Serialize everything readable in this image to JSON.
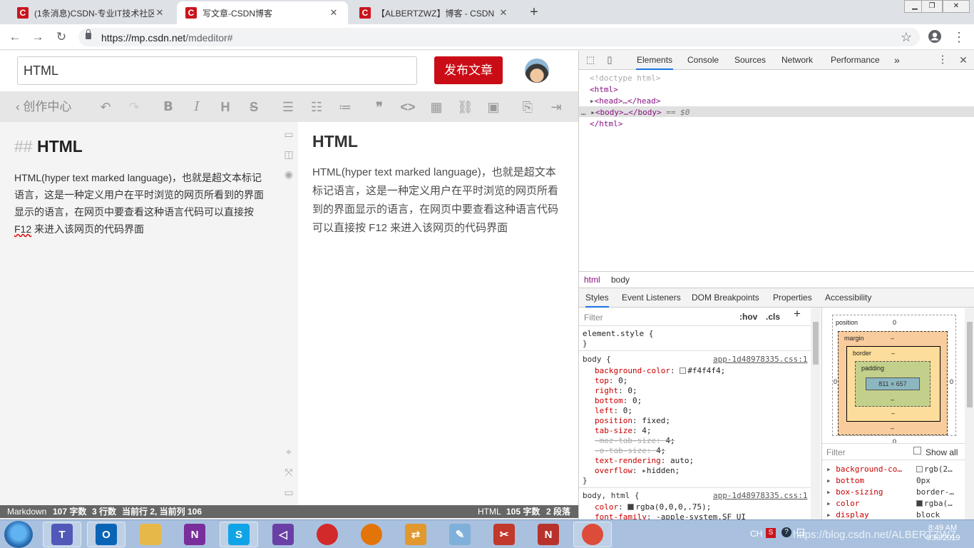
{
  "browser": {
    "tabs": [
      {
        "favicon": "C",
        "title": "(1条消息)CSDN-专业IT技术社区",
        "active": false
      },
      {
        "favicon": "C",
        "title": "写文章-CSDN博客",
        "active": true
      },
      {
        "favicon": "C",
        "title": "【ALBERTZWZ】博客 - CSDN",
        "active": false
      }
    ],
    "new_tab": "+",
    "close": "✕",
    "url_host": "https://mp.csdn.net",
    "url_path": "/mdeditor#",
    "window_buttons": [
      "▁",
      "❐",
      "✕"
    ]
  },
  "editor": {
    "title_value": "HTML",
    "publish_label": "发布文章",
    "back_label": "创作中心",
    "toolbar_icons": [
      "undo-icon",
      "redo-icon",
      "bold-icon",
      "italic-icon",
      "heading-icon",
      "strikethrough-icon",
      "unordered-list-icon",
      "ordered-list-icon",
      "task-list-icon",
      "quote-icon",
      "code-icon",
      "table-icon",
      "link-icon",
      "image-icon",
      "import-icon",
      "export-icon"
    ],
    "source": {
      "heading_marker": "##",
      "heading_text": "HTML",
      "para_before": "HTML(hyper text marked language)，也就是超文本标记语言，这是一种定义用户在平时浏览的网页所看到的界面显示的语言，在网页中要查看这种语言代码可以直接按 ",
      "para_key": "F12",
      "para_after": " 来进入该网页的代码界面"
    },
    "preview": {
      "heading": "HTML",
      "paragraph": "HTML(hyper text marked language)，也就是超文本标记语言，这是一种定义用户在平时浏览的网页所看到的界面显示的语言，在网页中要查看这种语言代码可以直接按 F12 来进入该网页的代码界面"
    },
    "status_left": {
      "mode": "Markdown",
      "words": "107 字数",
      "lines": "3 行数",
      "cursor": "当前行 2, 当前列 106"
    },
    "status_right": {
      "mode": "HTML",
      "words": "105 字数",
      "paras": "2 段落"
    }
  },
  "devtools": {
    "tabs": [
      "Elements",
      "Console",
      "Sources",
      "Network",
      "Performance"
    ],
    "more": "»",
    "dom": {
      "doctype": "<!doctype html>",
      "html_open": "<html>",
      "head": "<head>…</head>",
      "body": "<body>…</body>",
      "body_eq": "== $0",
      "html_close": "</html>",
      "ellipsis": "…"
    },
    "breadcrumbs": [
      "html",
      "body"
    ],
    "style_tabs": [
      "Styles",
      "Event Listeners",
      "DOM Breakpoints",
      "Properties",
      "Accessibility"
    ],
    "filter_placeholder": "Filter",
    "hov": ":hov",
    "cls": ".cls",
    "add": "+",
    "element_style": "element.style {",
    "close_brace": "}",
    "body_rule": {
      "selector": "body {",
      "source": "app-1d48978335.css:1",
      "decls": [
        {
          "prop": "background-color",
          "val": "#f4f4f4;",
          "swatch": "#f4f4f4",
          "struck": false
        },
        {
          "prop": "top",
          "val": "0;",
          "struck": false
        },
        {
          "prop": "right",
          "val": "0;",
          "struck": false
        },
        {
          "prop": "bottom",
          "val": "0;",
          "struck": false
        },
        {
          "prop": "left",
          "val": "0;",
          "struck": false
        },
        {
          "prop": "position",
          "val": "fixed;",
          "struck": false
        },
        {
          "prop": "tab-size",
          "val": "4;",
          "struck": false
        },
        {
          "prop": "-moz-tab-size",
          "val": "4;",
          "struck": true
        },
        {
          "prop": "-o-tab-size",
          "val": "4;",
          "struck": true
        },
        {
          "prop": "text-rendering",
          "val": "auto;",
          "struck": false
        },
        {
          "prop": "overflow",
          "val": "hidden;",
          "struck": false,
          "expand": true
        }
      ]
    },
    "body_html_rule": {
      "selector": "body, html {",
      "source": "app-1d48978335.css:1",
      "decls": [
        {
          "prop": "color",
          "val": "rgba(0,0,0,.75);",
          "swatch": "#404040"
        },
        {
          "prop": "font-family",
          "val": "-apple-system,SF UI"
        }
      ]
    },
    "box_model": {
      "position_label": "position",
      "position": "0",
      "margin_label": "margin",
      "border_label": "border",
      "padding_label": "padding",
      "dash": "–",
      "side_zero": "0",
      "content": "811 × 657"
    },
    "computed_filter": "Filter",
    "show_all": "Show all",
    "computed": [
      {
        "prop": "background-co…",
        "val": "rgb(2…",
        "swatch": "#f4f4f4"
      },
      {
        "prop": "bottom",
        "val": "0px"
      },
      {
        "prop": "box-sizing",
        "val": "border-…"
      },
      {
        "prop": "color",
        "val": "rgba(…",
        "swatch": "#404040"
      },
      {
        "prop": "display",
        "val": "block"
      }
    ]
  },
  "taskbar": {
    "apps": [
      {
        "icon": "teams-icon",
        "glyph": "T",
        "color": "#5058b8",
        "running": true
      },
      {
        "icon": "outlook-icon",
        "glyph": "O",
        "color": "#0a64b6",
        "running": true
      },
      {
        "icon": "file-explorer-icon",
        "glyph": "",
        "color": "#e6b84a",
        "running": false
      },
      {
        "icon": "onenote-icon",
        "glyph": "N",
        "color": "#7a2e9c",
        "running": false
      },
      {
        "icon": "skype-icon",
        "glyph": "S",
        "color": "#0fa4e6",
        "running": true
      },
      {
        "icon": "visual-studio-icon",
        "glyph": "◁",
        "color": "#6a3fa6",
        "running": false
      },
      {
        "icon": "red-sphere-icon",
        "glyph": "",
        "color": "#d22a2a",
        "running": false
      },
      {
        "icon": "orange-sphere-icon",
        "glyph": "",
        "color": "#e3740a",
        "running": false
      },
      {
        "icon": "file-transfer-icon",
        "glyph": "⇄",
        "color": "#e0982f",
        "running": false
      },
      {
        "icon": "notepad-icon",
        "glyph": "✎",
        "color": "#7fb0d9",
        "running": false
      },
      {
        "icon": "snipping-tool-icon",
        "glyph": "✂",
        "color": "#c0392b",
        "running": false
      },
      {
        "icon": "app-n-icon",
        "glyph": "N",
        "color": "#b8322d",
        "running": false
      },
      {
        "icon": "chrome-icon",
        "glyph": "",
        "color": "#dd4b39",
        "running": true
      }
    ],
    "lang": "CH",
    "watermark": "https://blog.csdn.net/ALBERTZWZ",
    "time": "8:49 AM",
    "date": "4/30/2019"
  },
  "colors": {
    "accent_red": "#ca0c16",
    "devtools_blue": "#1a73e8"
  }
}
